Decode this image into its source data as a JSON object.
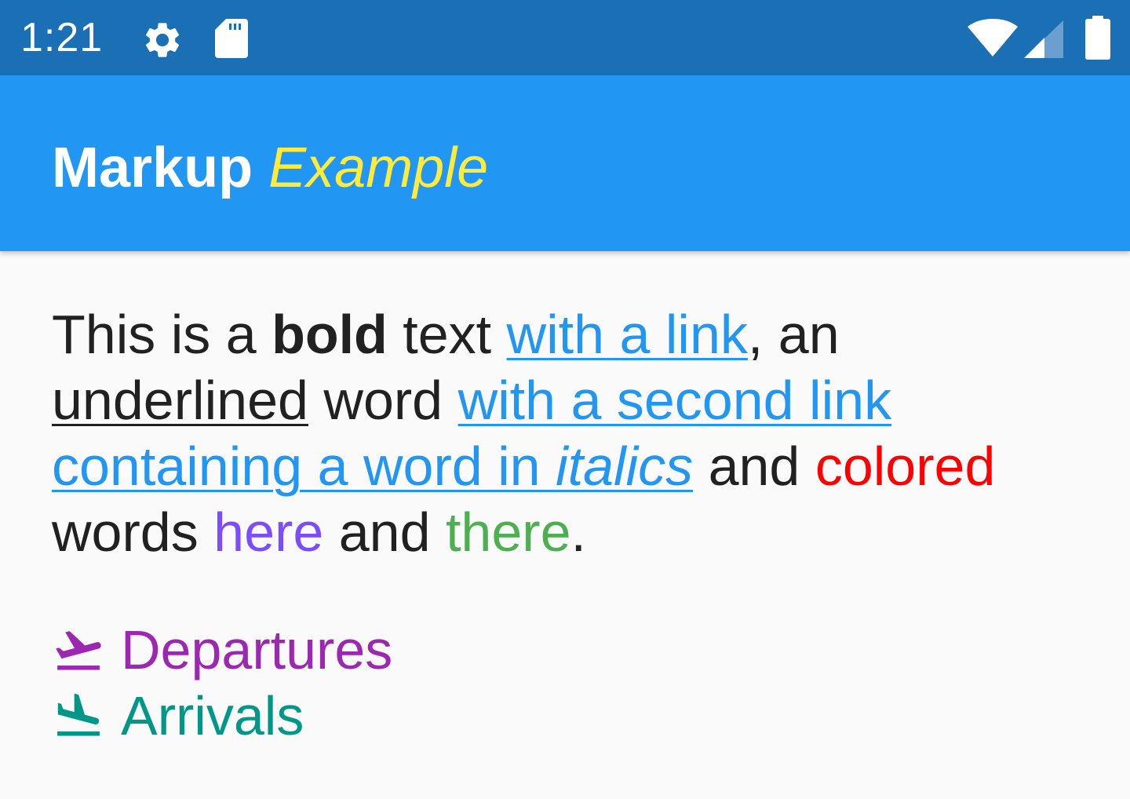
{
  "status_bar": {
    "time": "1:21",
    "icons": [
      "gear-icon",
      "sd-card-icon",
      "wifi-icon",
      "cell-signal-icon",
      "battery-icon"
    ],
    "background": "#1a6fb5"
  },
  "app_bar": {
    "title_bold": "Markup",
    "title_italic": "Example",
    "background": "#2196f3",
    "italic_color": "#ffeb3b"
  },
  "paragraph": {
    "t1": "This is a ",
    "bold": "bold",
    "t2": " text ",
    "link1": "with a link",
    "t3": ", an",
    "underlined": "underlined",
    "t4": " word ",
    "link2_a": "with a second link ",
    "link2_b": "containing a word in ",
    "link2_italic": "italics",
    "t5": " and ",
    "colored": "colored",
    "t6": "words ",
    "here": "here",
    "t7": " and ",
    "there": "there",
    "t8": ".",
    "colors": {
      "text": "#212121",
      "link": "#2196f3",
      "colored": "#ff0000",
      "here": "#7c4dff",
      "there": "#4caf50"
    }
  },
  "flights": [
    {
      "icon": "flight-takeoff-icon",
      "label": "Departures",
      "color": "#9c27b0"
    },
    {
      "icon": "flight-land-icon",
      "label": "Arrivals",
      "color": "#009688"
    }
  ]
}
